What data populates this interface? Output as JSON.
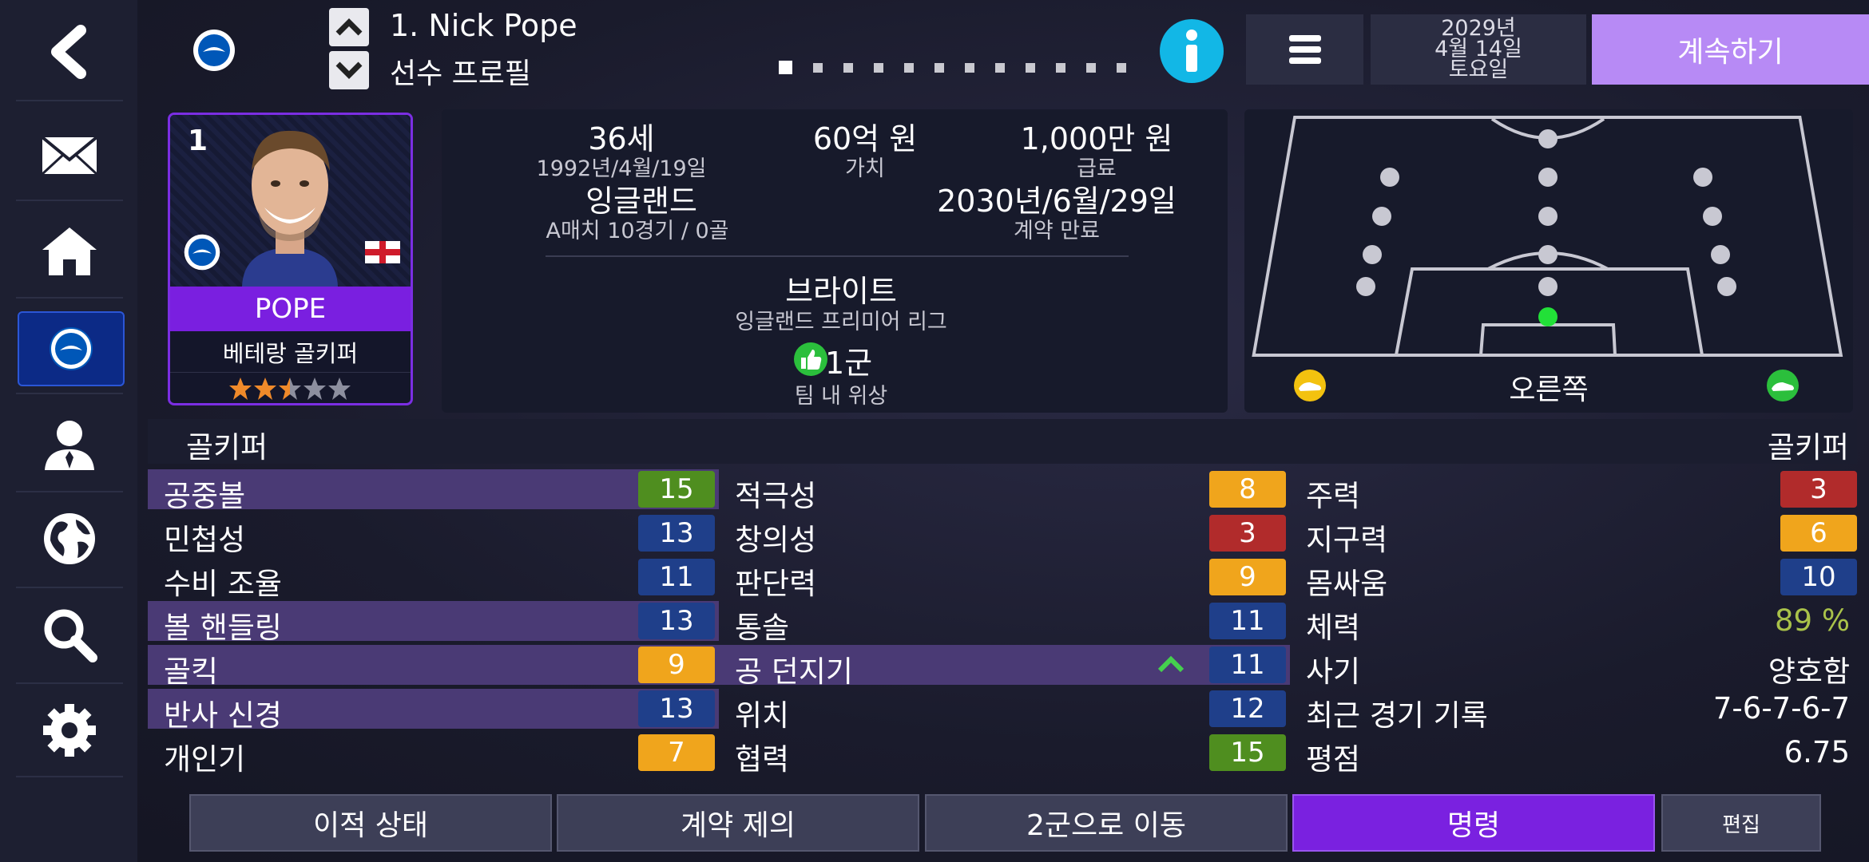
{
  "header": {
    "player_title": "1. Nick Pope",
    "subtitle": "선수 프로필",
    "date": {
      "year": "2029년",
      "month_day": "4월 14일",
      "weekday": "토요일"
    },
    "continue_label": "계속하기",
    "page_dots": 12,
    "active_dot": 1
  },
  "sidebar": {
    "items": [
      "back-icon",
      "mail-icon",
      "home-icon",
      "club-crest-icon",
      "manager-icon",
      "globe-icon",
      "search-icon",
      "gear-icon"
    ],
    "active": "club-crest-icon"
  },
  "card": {
    "number": "1",
    "name": "POPE",
    "role": "베테랑 골키퍼",
    "stars": 2.5,
    "stars_max": 5
  },
  "info": {
    "age": "36세",
    "birthdate": "1992년/4월/19일",
    "value": "60억 원",
    "value_label": "가치",
    "wage": "1,000만 원",
    "wage_label": "급료",
    "nation": "잉글랜드",
    "caps": "A매치 10경기 / 0골",
    "contract_end": "2030년/6월/29일",
    "contract_label": "계약 만료",
    "club": "브라이트",
    "league": "잉글랜드 프리미어 리그",
    "squad": "1군",
    "squad_label": "팀 내 위상"
  },
  "pitch": {
    "foot_label": "오른쪽"
  },
  "attributes": {
    "left_title": "골키퍼",
    "right_title": "골키퍼",
    "col1": [
      {
        "label": "공중볼",
        "value": "15",
        "color": "green",
        "hl": true
      },
      {
        "label": "민첩성",
        "value": "13",
        "color": "blue",
        "hl": false
      },
      {
        "label": "수비 조율",
        "value": "11",
        "color": "blue",
        "hl": false
      },
      {
        "label": "볼 핸들링",
        "value": "13",
        "color": "blue",
        "hl": true
      },
      {
        "label": "골킥",
        "value": "9",
        "color": "yellow",
        "hl": true
      },
      {
        "label": "반사 신경",
        "value": "13",
        "color": "blue",
        "hl": true
      },
      {
        "label": "개인기",
        "value": "7",
        "color": "yellow",
        "hl": false
      }
    ],
    "col2": [
      {
        "label": "적극성",
        "value": "8",
        "color": "yellow",
        "hl": false
      },
      {
        "label": "창의성",
        "value": "3",
        "color": "red",
        "hl": false
      },
      {
        "label": "판단력",
        "value": "9",
        "color": "yellow",
        "hl": false
      },
      {
        "label": "통솔",
        "value": "11",
        "color": "blue",
        "hl": false
      },
      {
        "label": "공 던지기",
        "value": "11",
        "color": "blue",
        "hl": true
      },
      {
        "label": "위치",
        "value": "12",
        "color": "blue",
        "hl": false
      },
      {
        "label": "협력",
        "value": "15",
        "color": "green",
        "hl": false
      }
    ],
    "col3": [
      {
        "label": "주력",
        "value": "3",
        "color": "red"
      },
      {
        "label": "지구력",
        "value": "6",
        "color": "yellow"
      },
      {
        "label": "몸싸움",
        "value": "10",
        "color": "blue"
      },
      {
        "label": "체력",
        "text": "89 %"
      },
      {
        "label": "사기",
        "text": "양호함"
      },
      {
        "label": "최근 경기 기록",
        "text": "7-6-7-6-7"
      },
      {
        "label": "평점",
        "text": "6.75"
      }
    ]
  },
  "buttons": {
    "transfer": "이적 상태",
    "offer": "계약 제의",
    "move": "2군으로 이동",
    "command": "명령",
    "edit": "편집"
  }
}
